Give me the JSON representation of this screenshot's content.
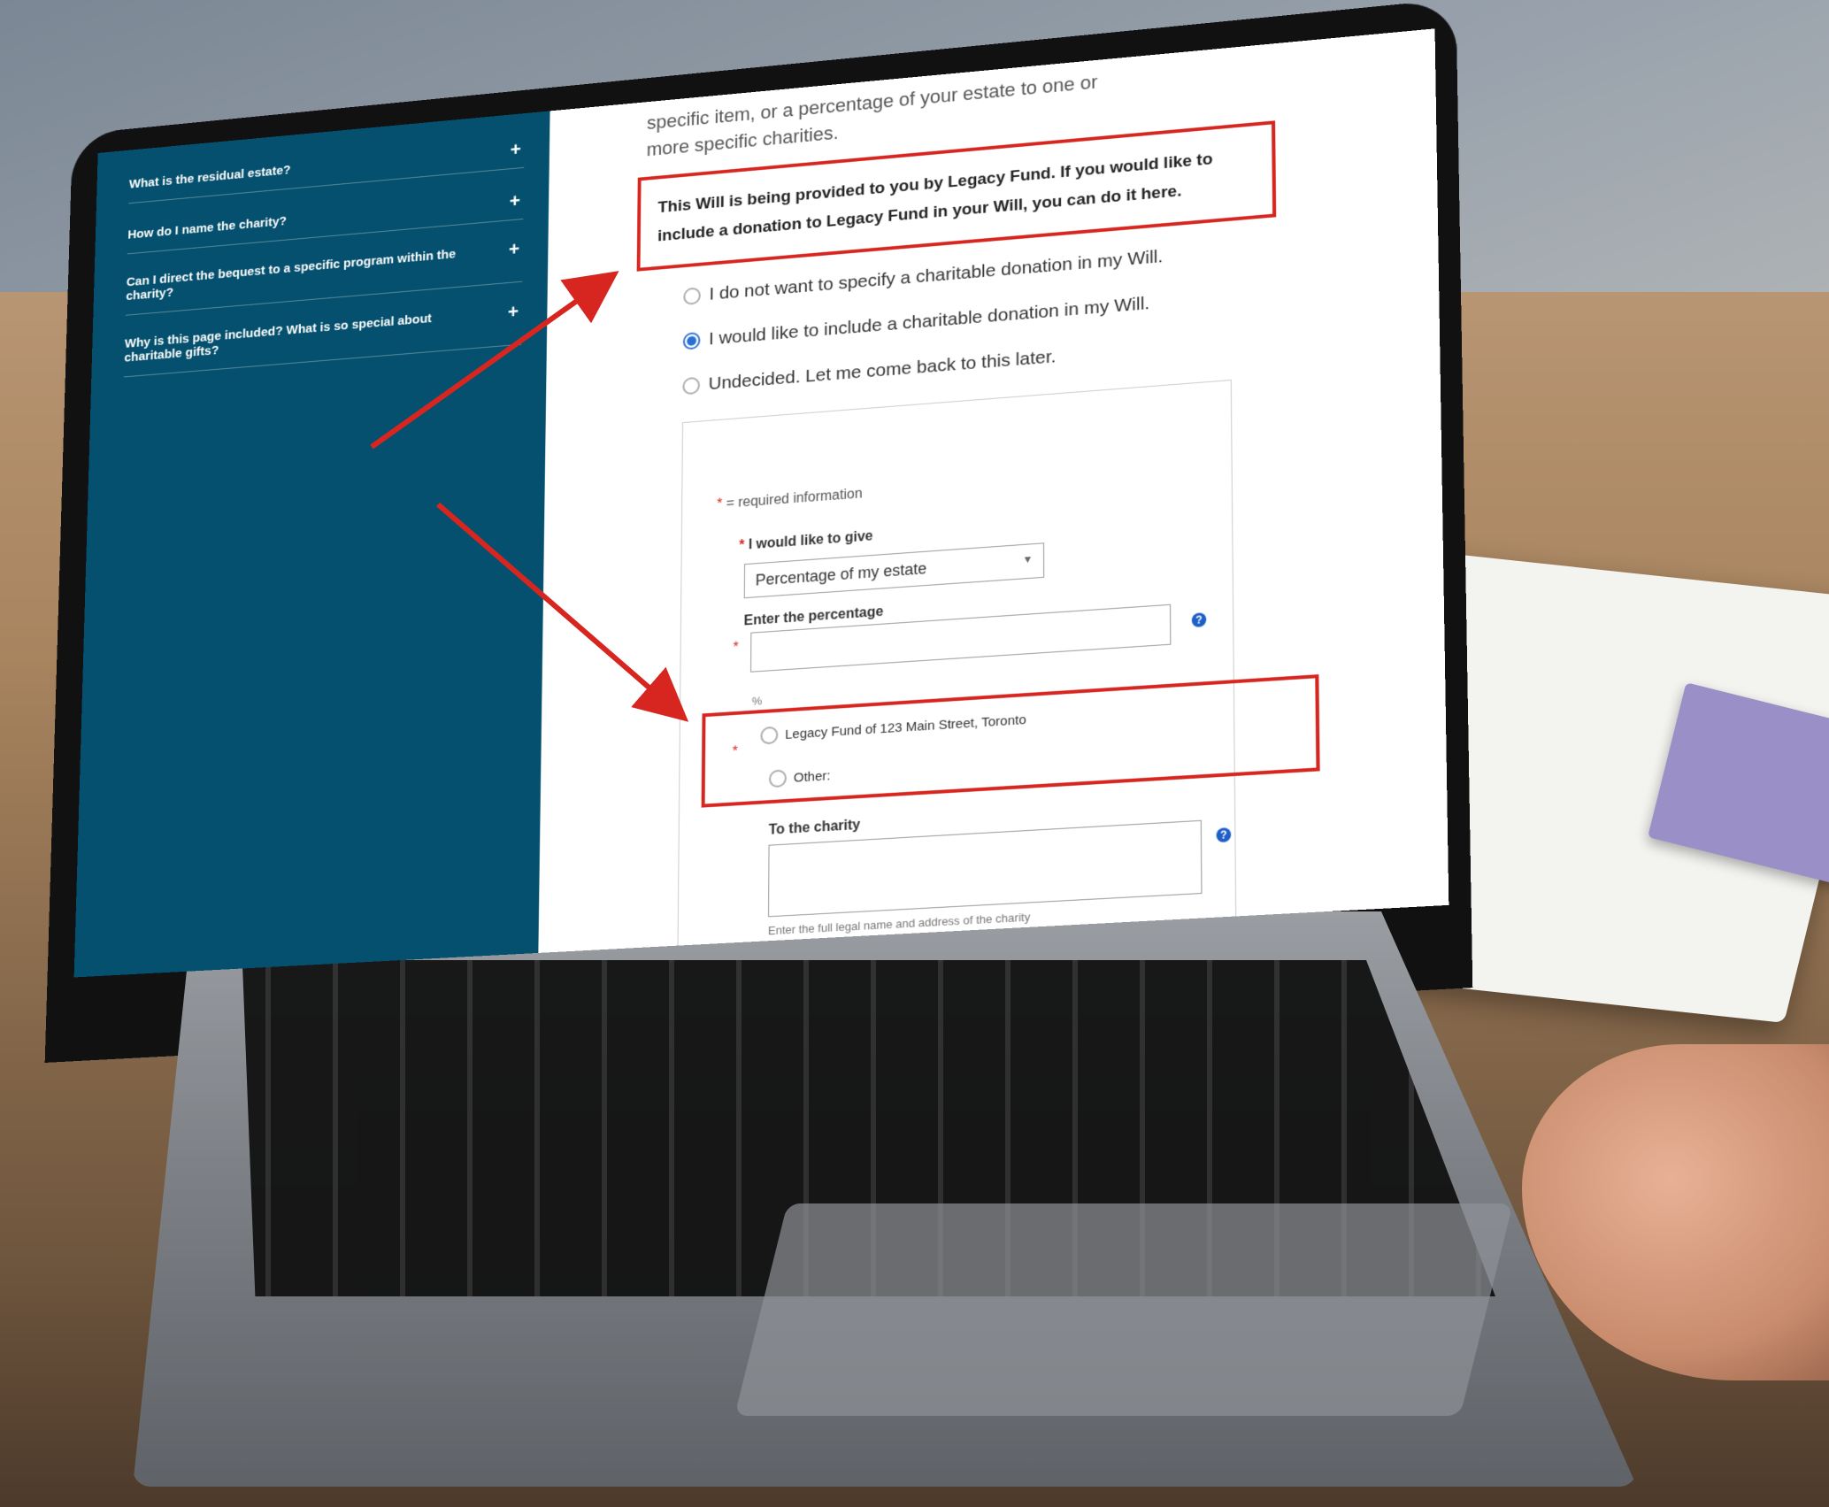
{
  "sidebar": {
    "items": [
      {
        "label": "What is the residual estate?"
      },
      {
        "label": "How do I name the charity?"
      },
      {
        "label": "Can I direct the bequest to a specific program within the charity?"
      },
      {
        "label": "Why is this page included? What is so special about charitable gifts?"
      }
    ]
  },
  "main": {
    "intro": "specific item, or a percentage of your estate to one or more specific charities.",
    "callout": "This Will is being provided to you by Legacy Fund. If you would like to include a donation to Legacy Fund in your Will, you can do it here.",
    "options": [
      {
        "label": "I do not want to specify a charitable donation in my Will.",
        "selected": false
      },
      {
        "label": "I would like to include a charitable donation in my Will.",
        "selected": true
      },
      {
        "label": "Undecided. Let me come back to this later.",
        "selected": false
      }
    ],
    "required_note": "= required information",
    "give_label": "I would like to give",
    "give_value": "Percentage of my estate",
    "percentage_label": "Enter the percentage",
    "percentage_value": "",
    "percent_sign": "%",
    "charity_options": [
      {
        "label": "Legacy Fund of 123 Main Street, Toronto"
      },
      {
        "label": "Other:"
      }
    ],
    "to_charity_label": "To the charity",
    "to_charity_value": "",
    "to_charity_hint": "Enter the full legal name and address of the charity"
  },
  "colors": {
    "sidebar": "#04506e",
    "highlight": "#d6261f",
    "radio_selected": "#2a6fd6"
  }
}
